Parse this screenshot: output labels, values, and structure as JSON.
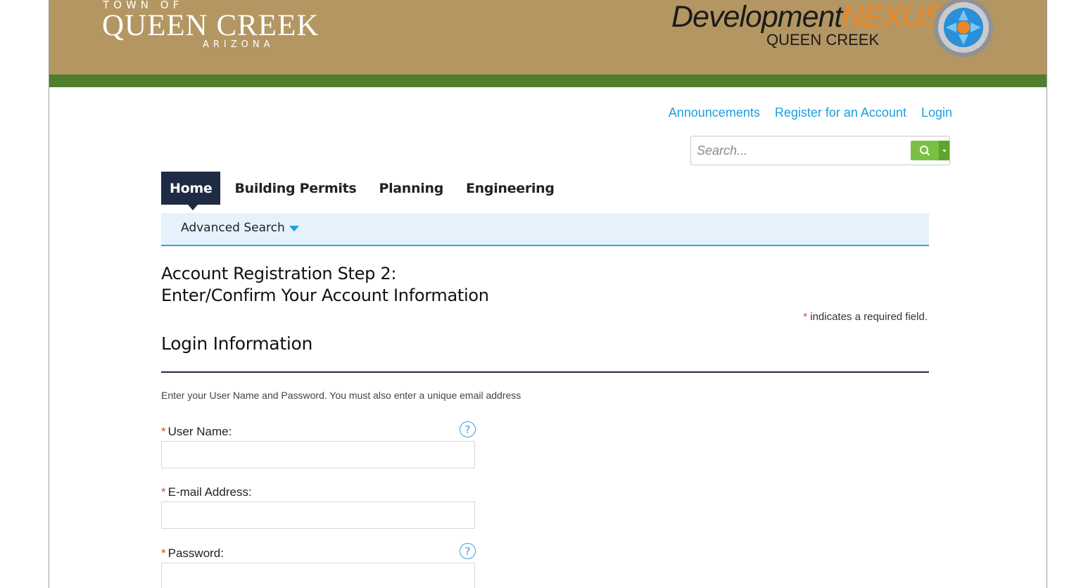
{
  "header": {
    "town_small": "TOWN OF",
    "town_name": "QUEEN CREEK",
    "town_state": "ARIZONA",
    "nexus_dev": "Development",
    "nexus_word": "NEXUS",
    "nexus_sub": "QUEEN CREEK",
    "colors": {
      "banner": "#b39662",
      "green_strip": "#4f7e2d",
      "nexus_orange": "#f08524"
    }
  },
  "top_links": {
    "announcements": "Announcements",
    "register": "Register for an Account",
    "login": "Login"
  },
  "search": {
    "placeholder": "Search...",
    "button_icon": "search-icon"
  },
  "tabs": [
    {
      "label": "Home",
      "active": true
    },
    {
      "label": "Building Permits",
      "active": false
    },
    {
      "label": "Planning",
      "active": false
    },
    {
      "label": "Engineering",
      "active": false
    }
  ],
  "subnav": {
    "advanced_search": "Advanced Search"
  },
  "page": {
    "title_line1": "Account Registration Step 2:",
    "title_line2": "Enter/Confirm Your Account Information",
    "required_star": "*",
    "required_note": " indicates a required field.",
    "section_title": "Login Information",
    "instructions": "Enter your User Name and Password.  You must also enter a unique email address"
  },
  "fields": {
    "username": {
      "star": "*",
      "label": "User Name:",
      "value": "",
      "help": "?"
    },
    "email": {
      "star": "*",
      "label": "E-mail Address:",
      "value": ""
    },
    "password": {
      "star": "*",
      "label": "Password:",
      "value": "",
      "help": "?"
    }
  }
}
